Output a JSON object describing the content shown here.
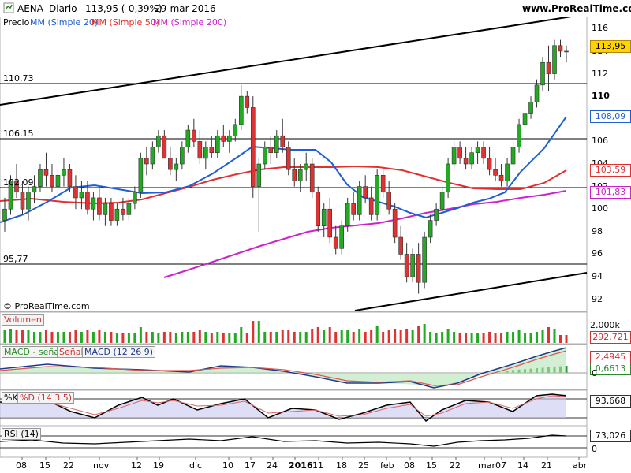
{
  "header": {
    "symbol": "AENA",
    "period": "Diario",
    "last": "113,95 (-0,39%)",
    "date": "29-mar-2016",
    "brand": "www.ProRealTime.com"
  },
  "legend": {
    "price": "Precio",
    "ma20": "MM (Simple 20)",
    "ma50": "MM (Simple 50)",
    "ma200": "MM (Simple 200)"
  },
  "colors": {
    "up": "#22aa22",
    "down": "#dd3333",
    "ma20": "#1f5fd6",
    "ma50": "#e03030",
    "ma200": "#cc22cc",
    "price_box": "#ffd200",
    "ma20_box": "#1f5fd6",
    "ma50_box": "#e03030",
    "ma200_box": "#cc22cc"
  },
  "price_levels": [
    "110,73",
    "106,15",
    "102,09",
    "95,77"
  ],
  "price_axis": [
    "116",
    "114",
    "112",
    "110",
    "108",
    "106",
    "104",
    "102",
    "100",
    "98",
    "96",
    "94",
    "92"
  ],
  "price_tags": {
    "last": "113,95",
    "ma20": "108,09",
    "ma50": "103,59",
    "ma200": "101,83"
  },
  "copyright": "© ProRealTime.com",
  "volume": {
    "label": "Volumen",
    "axis_top": "2.000k",
    "value": "292.721"
  },
  "macd": {
    "label1": "MACD - señal",
    "label2": "Señal",
    "label3": "MACD (12 26 9)",
    "v1": "2,4945",
    "v2": "0,6613",
    "zero": "0"
  },
  "stoch": {
    "label1": "%K",
    "label2": "%D (14 3 5)",
    "value": "93,668"
  },
  "rsi": {
    "label": "RSI (14)",
    "value": "73,026",
    "zero": "0"
  },
  "x_axis": [
    "08",
    "15",
    "22",
    "nov",
    "12",
    "19",
    "dic",
    "10",
    "17",
    "24",
    "2016",
    "11",
    "18",
    "25",
    "feb",
    "08",
    "15",
    "22",
    "mar",
    "07",
    "14",
    "21",
    "abr"
  ],
  "chart_data": {
    "type": "candlestick",
    "title": "AENA Diario 113,95 (-0,39%) 29-mar-2016",
    "ylim": [
      91,
      117
    ],
    "candles": [
      [
        99,
        101,
        98,
        100
      ],
      [
        100,
        103,
        99.5,
        102.5
      ],
      [
        102.5,
        104,
        101,
        101.5
      ],
      [
        101.5,
        102.5,
        99.5,
        100
      ],
      [
        100,
        102,
        99,
        101.5
      ],
      [
        101.5,
        103,
        100.5,
        102
      ],
      [
        102,
        104,
        101.5,
        103.5
      ],
      [
        103.5,
        105,
        102,
        103
      ],
      [
        103,
        104,
        101.5,
        102
      ],
      [
        102,
        103.5,
        101,
        103
      ],
      [
        103,
        104.5,
        102,
        103.5
      ],
      [
        103.5,
        104,
        101.5,
        102
      ],
      [
        102,
        103,
        100,
        101
      ],
      [
        101,
        102.5,
        100,
        101.5
      ],
      [
        101.5,
        102.5,
        99.5,
        100
      ],
      [
        100,
        101.5,
        99,
        101
      ],
      [
        101,
        102,
        99,
        99.5
      ],
      [
        99.5,
        101,
        98.5,
        100.5
      ],
      [
        100.5,
        101,
        98.5,
        99
      ],
      [
        99,
        100.5,
        98.5,
        100
      ],
      [
        100,
        101,
        99,
        99.5
      ],
      [
        99.5,
        101,
        99,
        100.5
      ],
      [
        100.5,
        102,
        100,
        101.5
      ],
      [
        101.5,
        105,
        101,
        104.5
      ],
      [
        104.5,
        105.5,
        103,
        104
      ],
      [
        104,
        106,
        103.5,
        105.5
      ],
      [
        105.5,
        107,
        105,
        106.5
      ],
      [
        106.5,
        107,
        104.5,
        104.5
      ],
      [
        104.5,
        105.5,
        103,
        103.5
      ],
      [
        103.5,
        104.5,
        102.5,
        104
      ],
      [
        104,
        106,
        103.5,
        105.5
      ],
      [
        105.5,
        107.5,
        105,
        107
      ],
      [
        107,
        108,
        105.5,
        106
      ],
      [
        106,
        107,
        104,
        104.5
      ],
      [
        104.5,
        106,
        103.5,
        105.5
      ],
      [
        105.5,
        106.5,
        104.5,
        105
      ],
      [
        105,
        107,
        104.5,
        106.5
      ],
      [
        106.5,
        107.5,
        105.5,
        106
      ],
      [
        106,
        107,
        105,
        106.5
      ],
      [
        106.5,
        108,
        106,
        107.5
      ],
      [
        107.5,
        111,
        107,
        110
      ],
      [
        110,
        110.5,
        108.5,
        109
      ],
      [
        109,
        110,
        101,
        102
      ],
      [
        102,
        104.5,
        98,
        104
      ],
      [
        104,
        106,
        103.5,
        105.5
      ],
      [
        105.5,
        106.5,
        104,
        105
      ],
      [
        105,
        107,
        104.5,
        106.5
      ],
      [
        106.5,
        108,
        105,
        105.5
      ],
      [
        105.5,
        106,
        103,
        103.5
      ],
      [
        103.5,
        104.5,
        102,
        102.5
      ],
      [
        102.5,
        104,
        101.5,
        103.5
      ],
      [
        103.5,
        105,
        102.5,
        104
      ],
      [
        104,
        104.5,
        101,
        101.5
      ],
      [
        101.5,
        102,
        98,
        98.5
      ],
      [
        98.5,
        100.5,
        97.5,
        100
      ],
      [
        100,
        101,
        97,
        97.5
      ],
      [
        97.5,
        98.5,
        96,
        96.5
      ],
      [
        96.5,
        99,
        96,
        98.5
      ],
      [
        98.5,
        101,
        98,
        100.5
      ],
      [
        100.5,
        101.5,
        99,
        99.5
      ],
      [
        99.5,
        102.5,
        99,
        102
      ],
      [
        102,
        103,
        100.5,
        101
      ],
      [
        101,
        102,
        99,
        99.5
      ],
      [
        99.5,
        103.5,
        99,
        103
      ],
      [
        103,
        103.5,
        101,
        101.5
      ],
      [
        101.5,
        102.5,
        99.5,
        100
      ],
      [
        100,
        100.5,
        97,
        97.5
      ],
      [
        97.5,
        98.5,
        95.5,
        96
      ],
      [
        96,
        97,
        93.5,
        94
      ],
      [
        94,
        96.5,
        93.5,
        96
      ],
      [
        96,
        97,
        92.5,
        93.5
      ],
      [
        93.5,
        98,
        93,
        97.5
      ],
      [
        97.5,
        99.5,
        97,
        99
      ],
      [
        99,
        100.5,
        98.5,
        100
      ],
      [
        100,
        102,
        99.5,
        101.5
      ],
      [
        101.5,
        104.5,
        101,
        104
      ],
      [
        104,
        106,
        103.5,
        105.5
      ],
      [
        105.5,
        106,
        104,
        104.5
      ],
      [
        104.5,
        105.5,
        103.5,
        104
      ],
      [
        104,
        105.5,
        103.5,
        105
      ],
      [
        105,
        106,
        104,
        105.5
      ],
      [
        105.5,
        106,
        104,
        104.5
      ],
      [
        104.5,
        105.5,
        103,
        103.5
      ],
      [
        103.5,
        104.5,
        102.5,
        103
      ],
      [
        103,
        104,
        102,
        102.5
      ],
      [
        102.5,
        104.5,
        102,
        104
      ],
      [
        104,
        106,
        103.5,
        105.5
      ],
      [
        105.5,
        108,
        105,
        107.5
      ],
      [
        107.5,
        109,
        107,
        108.5
      ],
      [
        108.5,
        110,
        108,
        109.5
      ],
      [
        109.5,
        111.5,
        109,
        111
      ],
      [
        111,
        113.5,
        110.5,
        113
      ],
      [
        113,
        114.5,
        110.5,
        112
      ],
      [
        112,
        115,
        111.5,
        114.5
      ],
      [
        114.5,
        115,
        113.5,
        114
      ],
      [
        114,
        114.5,
        113,
        113.95
      ]
    ]
  }
}
